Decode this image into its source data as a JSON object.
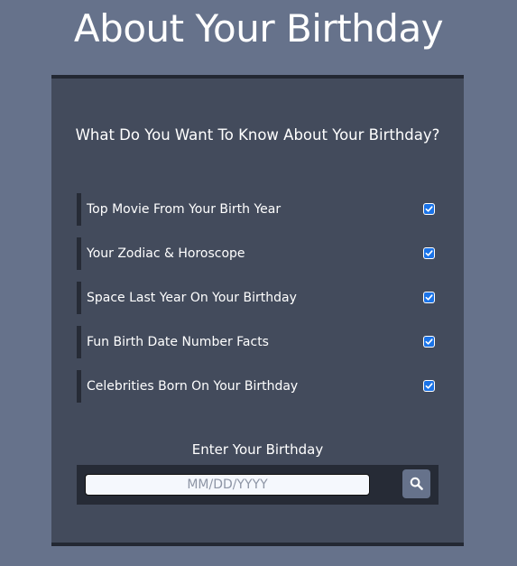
{
  "page": {
    "title": "About Your Birthday"
  },
  "card": {
    "question": "What Do You Want To Know About Your Birthday?",
    "options": [
      {
        "label": "Top Movie From Your Birth Year",
        "checked": true
      },
      {
        "label": "Your Zodiac & Horoscope",
        "checked": true
      },
      {
        "label": "Space Last Year On Your Birthday",
        "checked": true
      },
      {
        "label": "Fun Birth Date Number Facts",
        "checked": true
      },
      {
        "label": "Celebrities Born On Your Birthday",
        "checked": true
      }
    ],
    "enter_label": "Enter Your Birthday",
    "date_input": {
      "value": "",
      "placeholder": "MM/DD/YYYY"
    },
    "search_button_icon": "search-icon"
  },
  "colors": {
    "background": "#66728b",
    "card": "#434b5c",
    "dark_accent": "#232833",
    "checkbox": "#1a73e8"
  }
}
